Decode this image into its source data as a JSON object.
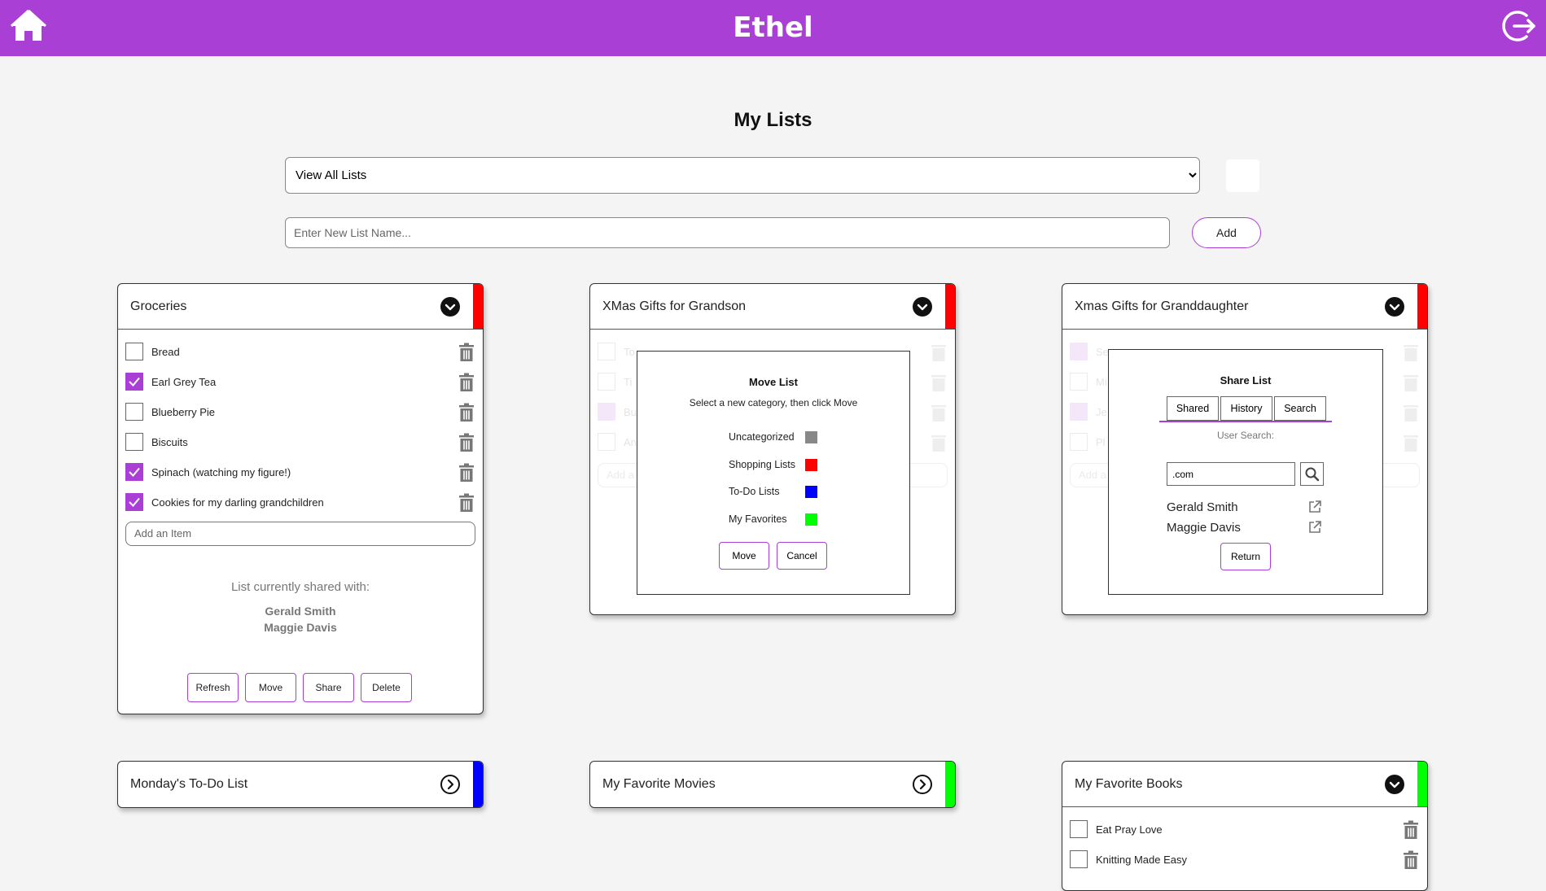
{
  "app": {
    "title": "Ethel"
  },
  "header": {
    "icons": [
      "home-icon",
      "logout-icon"
    ],
    "brand_color": "#aa3fd6"
  },
  "page": {
    "title": "My Lists"
  },
  "filter": {
    "selected": "View All Lists"
  },
  "new_list": {
    "placeholder": "Enter New List Name...",
    "add_label": "Add"
  },
  "cards": {
    "groceries": {
      "title": "Groceries",
      "color": "#ff0000",
      "items": [
        {
          "label": "Bread",
          "checked": false
        },
        {
          "label": "Earl Grey Tea",
          "checked": true
        },
        {
          "label": "Blueberry Pie",
          "checked": false
        },
        {
          "label": "Biscuits",
          "checked": false
        },
        {
          "label": "Spinach (watching my figure!)",
          "checked": true
        },
        {
          "label": "Cookies for my darling grandchildren",
          "checked": true
        }
      ],
      "add_item_placeholder": "Add an Item",
      "shared_heading": "List currently shared with:",
      "shared_with": [
        "Gerald Smith",
        "Maggie Davis"
      ],
      "buttons": {
        "refresh": "Refresh",
        "move": "Move",
        "share": "Share",
        "delete": "Delete"
      }
    },
    "grandson": {
      "title": "XMas Gifts for Grandson",
      "color": "#ff0000",
      "hidden_items": [
        "To",
        "Ti",
        "Bu",
        "An"
      ],
      "add_item_placeholder": "Add a",
      "move_modal": {
        "title": "Move List",
        "subtitle": "Select a new category, then click Move",
        "categories": [
          {
            "label": "Uncategorized",
            "color": "#888888"
          },
          {
            "label": "Shopping Lists",
            "color": "#ff0000"
          },
          {
            "label": "To-Do Lists",
            "color": "#0000ff"
          },
          {
            "label": "My Favorites",
            "color": "#00ff00"
          }
        ],
        "move_label": "Move",
        "cancel_label": "Cancel"
      }
    },
    "granddaughter": {
      "title": "Xmas Gifts for Granddaughter",
      "color": "#ff0000",
      "hidden_items": [
        "Se",
        "Mi",
        "Je",
        "Pl"
      ],
      "add_item_placeholder": "Add a",
      "share_modal": {
        "title": "Share List",
        "tabs": [
          "Shared",
          "History",
          "Search"
        ],
        "search_label": "User Search:",
        "search_value": ".com",
        "results": [
          "Gerald Smith",
          "Maggie Davis"
        ],
        "return_label": "Return"
      }
    },
    "monday": {
      "title": "Monday's To-Do List",
      "color": "#0000ff"
    },
    "movies": {
      "title": "My Favorite Movies",
      "color": "#00ff00"
    },
    "books": {
      "title": "My Favorite Books",
      "color": "#00ff00",
      "items": [
        {
          "label": "Eat Pray Love",
          "checked": false
        },
        {
          "label": "Knitting Made Easy",
          "checked": false
        }
      ]
    }
  }
}
